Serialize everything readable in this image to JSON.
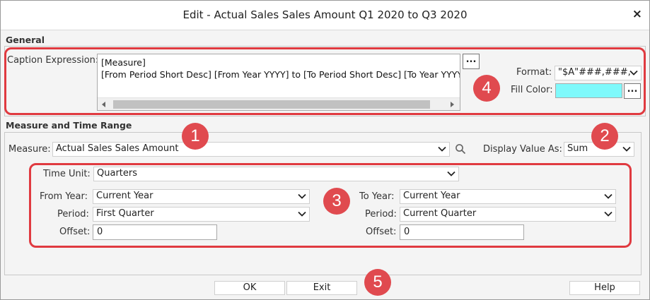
{
  "dialog": {
    "title": "Edit - Actual Sales Sales Amount Q1 2020 to Q3 2020",
    "close_glyph": "×"
  },
  "general": {
    "section_label": "General",
    "caption_label": "Caption Expression:",
    "caption_lines": "[Measure]\n[From Period Short Desc] [From Year YYYY] to [To Period Short Desc] [To Year YYYY]",
    "caption_button": "...",
    "format_label": "Format:",
    "format_value": "\"$A\"###,###,",
    "fill_label": "Fill Color:",
    "fill_color": "#7ff9fb",
    "fill_button": "..."
  },
  "measure_time": {
    "section_label": "Measure and Time Range",
    "measure_label": "Measure:",
    "measure_value": "Actual Sales Sales Amount",
    "display_label": "Display Value As:",
    "display_value": "Sum",
    "time_unit_label": "Time Unit:",
    "time_unit_value": "Quarters",
    "from_year_label": "From Year:",
    "from_year_value": "Current Year",
    "from_period_label": "Period:",
    "from_period_value": "First Quarter",
    "from_offset_label": "Offset:",
    "from_offset_value": "0",
    "to_year_label": "To Year:",
    "to_year_value": "Current Year",
    "to_period_label": "Period:",
    "to_period_value": "Current Quarter",
    "to_offset_label": "Offset:",
    "to_offset_value": "0"
  },
  "footer": {
    "ok_label": "OK",
    "exit_label": "Exit",
    "help_label": "Help"
  },
  "callouts": {
    "badge_1": "1",
    "badge_2": "2",
    "badge_3": "3",
    "badge_4": "4",
    "badge_5": "5",
    "accent_color": "#e03a40"
  },
  "icons": [
    "close-icon",
    "chevron-down-icon",
    "search-icon",
    "scroll-left-arrow",
    "scroll-right-arrow"
  ]
}
